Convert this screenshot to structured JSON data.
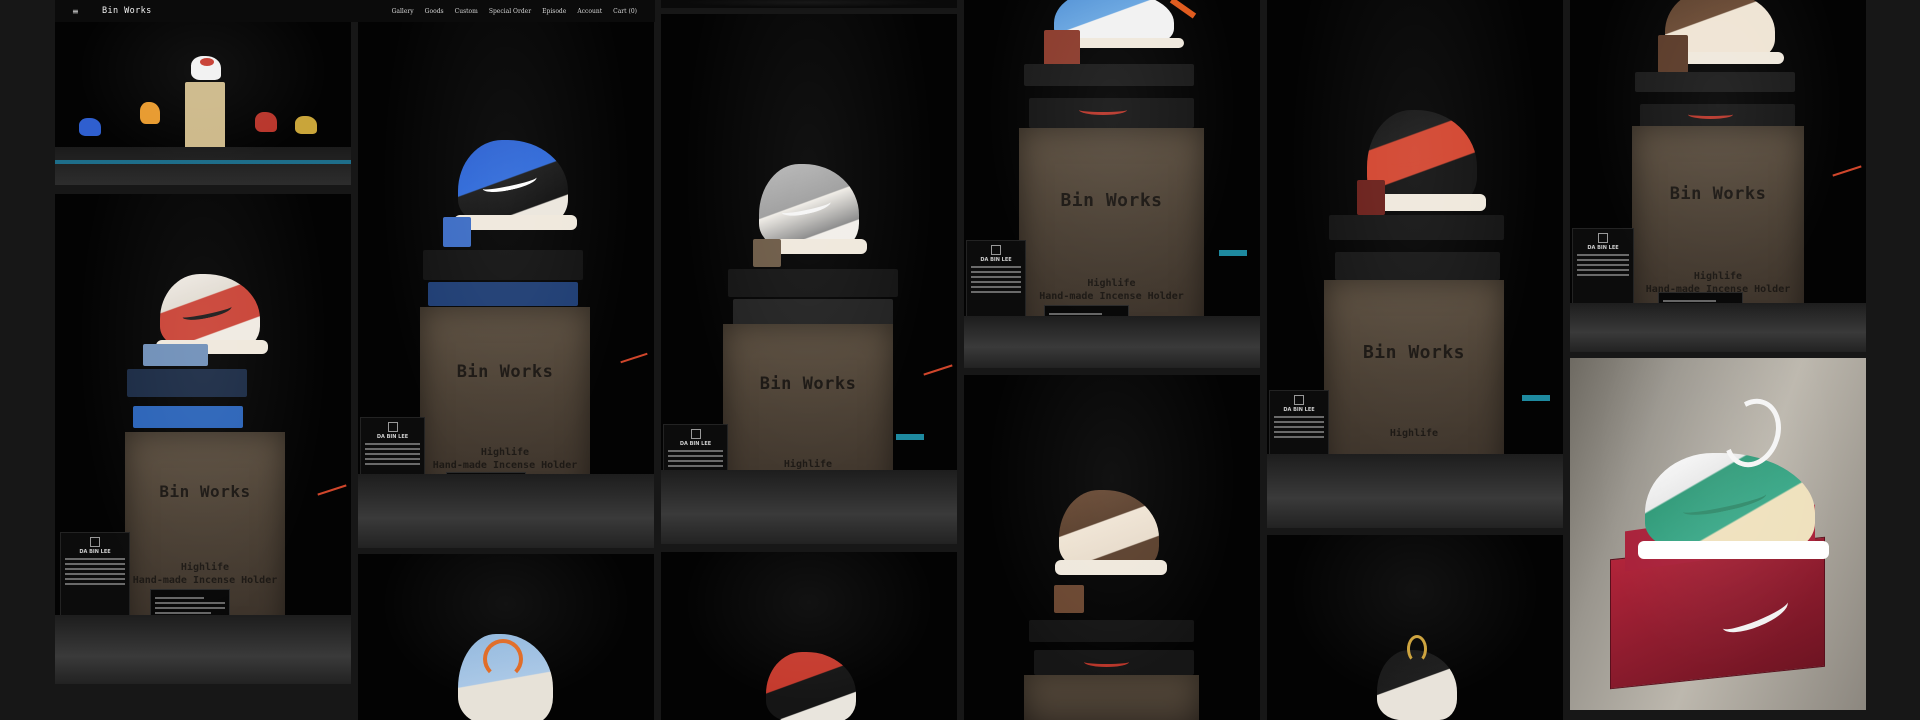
{
  "header": {
    "menu_icon": "≡",
    "brand": "Bin Works",
    "nav": [
      "Gallery",
      "Goods",
      "Custom",
      "Special Order",
      "Episode",
      "Account",
      "Cart (0)"
    ]
  },
  "exhibit": {
    "brand": "Bin Works",
    "line1": "Highlife",
    "line2": "Hand-made Incense Holder",
    "artist": "DA BIN LEE"
  },
  "theme": {
    "page_bg": "#171717",
    "tile_bg": "#030303",
    "plinth": "#4b4034",
    "accent_red": "#d0462b",
    "accent_teal": "#1e8aa0"
  }
}
